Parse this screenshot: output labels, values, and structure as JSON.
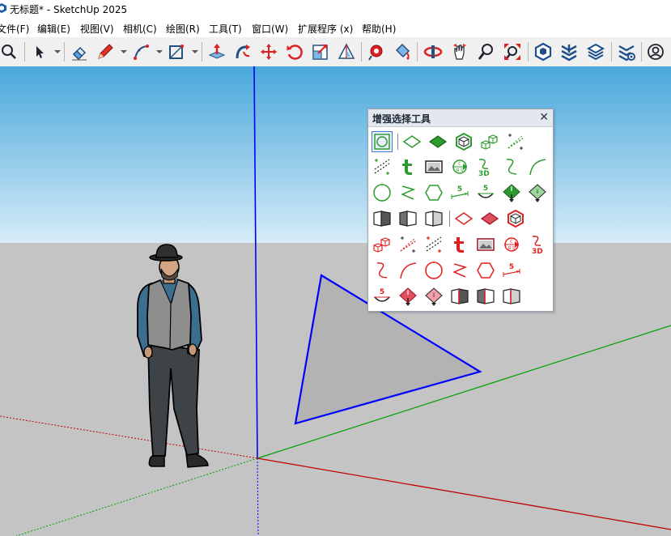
{
  "window": {
    "title": "无标题* - SketchUp 2025"
  },
  "menu": {
    "items": [
      "文件(F)",
      "编辑(E)",
      "视图(V)",
      "相机(C)",
      "绘图(R)",
      "工具(T)",
      "窗口(W)",
      "扩展程序 (x)",
      "帮助(H)"
    ]
  },
  "toolbar": {
    "icons": [
      "search-icon",
      "select-icon",
      "eraser-icon",
      "pencil-icon",
      "arc-icon",
      "rectangle-icon",
      "push-pull-icon",
      "follow-me-icon",
      "move-icon",
      "rotate-icon",
      "scale-icon",
      "offset-icon",
      "tape-measure-icon",
      "paint-bucket-icon",
      "orbit-icon",
      "pan-icon",
      "zoom-icon",
      "zoom-extents-icon",
      "warehouse-icon",
      "extension-warehouse-icon",
      "layout-icon",
      "extension-manager-icon",
      "account-icon"
    ]
  },
  "panel": {
    "title": "增强选择工具",
    "close": "✕"
  },
  "colors": {
    "sky_top": "#4aa8dc",
    "sky_bottom": "#d6ecf7",
    "ground": "#c4c4c4",
    "triangle_fill": "#b3b3b3",
    "triangle_edge": "#0000ff",
    "axis_red": "#c00000",
    "axis_green": "#00a000",
    "axis_blue": "#0000ff",
    "tool_green": "#2e9b2e",
    "tool_red": "#e02020"
  }
}
